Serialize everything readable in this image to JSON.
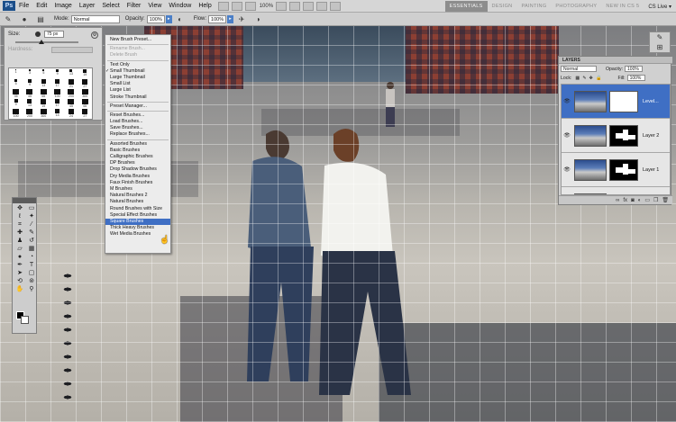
{
  "app": {
    "logo": "Ps"
  },
  "menubar": {
    "items": [
      "File",
      "Edit",
      "Image",
      "Layer",
      "Select",
      "Filter",
      "View",
      "Window",
      "Help"
    ],
    "zoom_menu": "100%"
  },
  "workspaces": {
    "items": [
      "ESSENTIALS",
      "DESIGN",
      "PAINTING",
      "PHOTOGRAPHY",
      "NEW IN CS 5"
    ],
    "active": "ESSENTIALS",
    "cslive": "CS Live ▾"
  },
  "options_bar": {
    "mode_label": "Mode:",
    "mode_value": "Normal",
    "opacity_label": "Opacity:",
    "opacity_value": "100%",
    "flow_label": "Flow:",
    "flow_value": "100%"
  },
  "brush_picker": {
    "size_label": "Size:",
    "size_value": "75 px",
    "hardness_label": "Hardness:",
    "presets": [
      {
        "num": "1",
        "s": 1
      },
      {
        "num": "3",
        "s": 2
      },
      {
        "num": "5",
        "s": 2
      },
      {
        "num": "9",
        "s": 3
      },
      {
        "num": "13",
        "s": 3
      },
      {
        "num": "19",
        "s": 4
      },
      {
        "num": "5",
        "s": 3
      },
      {
        "num": "9",
        "s": 4
      },
      {
        "num": "13",
        "s": 5
      },
      {
        "num": "17",
        "s": 5
      },
      {
        "num": "21",
        "s": 6
      },
      {
        "num": "27",
        "s": 6
      },
      {
        "num": "35",
        "s": 7
      },
      {
        "num": "45",
        "s": 7
      },
      {
        "num": "65",
        "s": 7
      },
      {
        "num": "100",
        "s": 7
      },
      {
        "num": "200",
        "s": 7
      },
      {
        "num": "300",
        "s": 7
      },
      {
        "num": "9",
        "s": 4
      },
      {
        "num": "13",
        "s": 5
      },
      {
        "num": "19",
        "s": 6
      },
      {
        "num": "17",
        "s": 5
      },
      {
        "num": "45",
        "s": 7
      },
      {
        "num": "65",
        "s": 7
      },
      {
        "num": "100",
        "s": 7
      },
      {
        "num": "200",
        "s": 7
      },
      {
        "num": "300",
        "s": 7
      },
      {
        "num": "14",
        "s": 5
      },
      {
        "num": "24",
        "s": 6
      },
      {
        "num": "27",
        "s": 6
      }
    ]
  },
  "brush_menu": {
    "groups": [
      [
        {
          "label": "New Brush Preset...",
          "state": ""
        }
      ],
      [
        {
          "label": "Rename Brush...",
          "state": "dis"
        },
        {
          "label": "Delete Brush",
          "state": "dis"
        }
      ],
      [
        {
          "label": "Text Only",
          "state": ""
        },
        {
          "label": "Small Thumbnail",
          "state": "chk"
        },
        {
          "label": "Large Thumbnail",
          "state": ""
        },
        {
          "label": "Small List",
          "state": ""
        },
        {
          "label": "Large List",
          "state": ""
        },
        {
          "label": "Stroke Thumbnail",
          "state": ""
        }
      ],
      [
        {
          "label": "Preset Manager...",
          "state": ""
        }
      ],
      [
        {
          "label": "Reset Brushes...",
          "state": ""
        },
        {
          "label": "Load Brushes...",
          "state": ""
        },
        {
          "label": "Save Brushes...",
          "state": ""
        },
        {
          "label": "Replace Brushes...",
          "state": ""
        }
      ],
      [
        {
          "label": "Assorted Brushes",
          "state": ""
        },
        {
          "label": "Basic Brushes",
          "state": ""
        },
        {
          "label": "Calligraphic Brushes",
          "state": ""
        },
        {
          "label": "DP Brushes",
          "state": ""
        },
        {
          "label": "Drop Shadow Brushes",
          "state": ""
        },
        {
          "label": "Dry Media Brushes",
          "state": ""
        },
        {
          "label": "Faux Finish Brushes",
          "state": ""
        },
        {
          "label": "M Brushes",
          "state": ""
        },
        {
          "label": "Natural Brushes 2",
          "state": ""
        },
        {
          "label": "Natural Brushes",
          "state": ""
        },
        {
          "label": "Round Brushes with Size",
          "state": ""
        },
        {
          "label": "Special Effect Brushes",
          "state": ""
        },
        {
          "label": "Square Brushes",
          "state": "hl"
        },
        {
          "label": "Thick Heavy Brushes",
          "state": ""
        },
        {
          "label": "Wet Media Brushes",
          "state": ""
        }
      ]
    ]
  },
  "layers_panel": {
    "title": "LAYERS",
    "blend_mode": "Normal",
    "opacity_label": "Opacity:",
    "opacity_value": "100%",
    "lock_label": "Lock:",
    "fill_label": "Fill:",
    "fill_value": "100%",
    "layers": [
      {
        "name": "Level...",
        "selected": true,
        "mask": "white"
      },
      {
        "name": "Layer 2",
        "selected": false,
        "mask": "black"
      },
      {
        "name": "Layer 1",
        "selected": false,
        "mask": "black"
      },
      {
        "name": "",
        "selected": false,
        "mask": "none"
      }
    ]
  },
  "colors": {
    "accent": "#3f6fc4",
    "brick": "#8c3f33"
  }
}
